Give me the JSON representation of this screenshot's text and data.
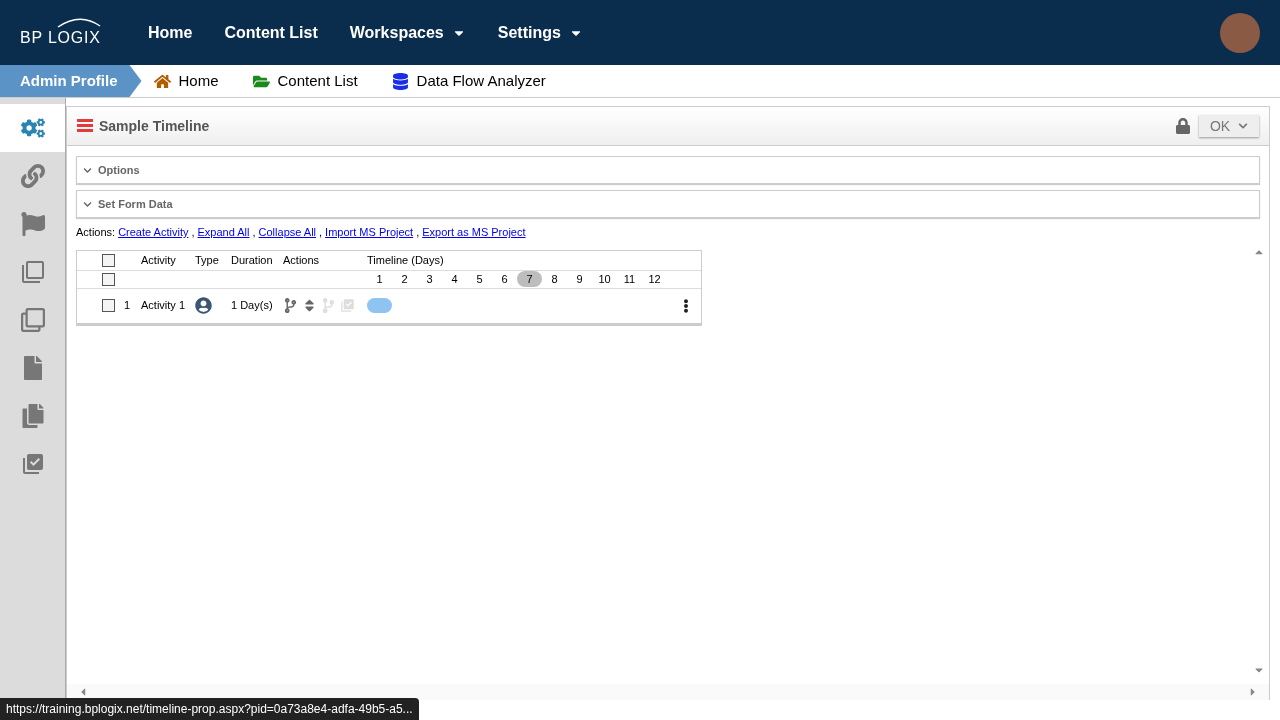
{
  "nav": {
    "logo": "BP LOGIX",
    "items": [
      {
        "label": "Home",
        "dropdown": false
      },
      {
        "label": "Content List",
        "dropdown": false
      },
      {
        "label": "Workspaces",
        "dropdown": true
      },
      {
        "label": "Settings",
        "dropdown": true
      }
    ]
  },
  "breadcrumb": {
    "profile": "Admin Profile",
    "links": [
      {
        "label": "Home",
        "kind": "home"
      },
      {
        "label": "Content List",
        "kind": "folder"
      },
      {
        "label": "Data Flow Analyzer",
        "kind": "database"
      }
    ]
  },
  "sidebar": {
    "items": [
      {
        "kind": "gears",
        "selected": true
      },
      {
        "kind": "link",
        "selected": false
      },
      {
        "kind": "flag",
        "selected": false
      },
      {
        "kind": "squares",
        "selected": false
      },
      {
        "kind": "copies",
        "selected": false
      },
      {
        "kind": "locked-file",
        "selected": false
      },
      {
        "kind": "pages",
        "selected": false
      },
      {
        "kind": "checked-pages",
        "selected": false
      }
    ]
  },
  "panel": {
    "title": "Sample Timeline",
    "ok_button": "OK",
    "sections": [
      {
        "label": "Options",
        "expanded": false
      },
      {
        "label": "Set Form Data",
        "expanded": false
      }
    ],
    "actions_label": "Actions:",
    "action_separator": ",",
    "actions": [
      "Create Activity",
      "Expand All",
      "Collapse All",
      "Import MS Project",
      "Export as MS Project"
    ],
    "table": {
      "columns": [
        "Activity",
        "Type",
        "Duration",
        "Actions",
        "Timeline (Days)"
      ],
      "header_checked": false,
      "days_checked": false,
      "days": [
        {
          "label": "1",
          "selected": false
        },
        {
          "label": "2",
          "selected": false
        },
        {
          "label": "3",
          "selected": false
        },
        {
          "label": "4",
          "selected": false
        },
        {
          "label": "5",
          "selected": false
        },
        {
          "label": "6",
          "selected": false
        },
        {
          "label": "7",
          "selected": true
        },
        {
          "label": "8",
          "selected": false
        },
        {
          "label": "9",
          "selected": false
        },
        {
          "label": "10",
          "selected": false
        },
        {
          "label": "11",
          "selected": false
        },
        {
          "label": "12",
          "selected": false
        }
      ],
      "rows": [
        {
          "checked": false,
          "number": "1",
          "activity": "Activity 1",
          "duration": "1 Day(s)"
        }
      ]
    }
  },
  "status_url": "https://training.bplogix.net/timeline-prop.aspx?pid=0a73a8e4-adfa-49b5-a5..."
}
